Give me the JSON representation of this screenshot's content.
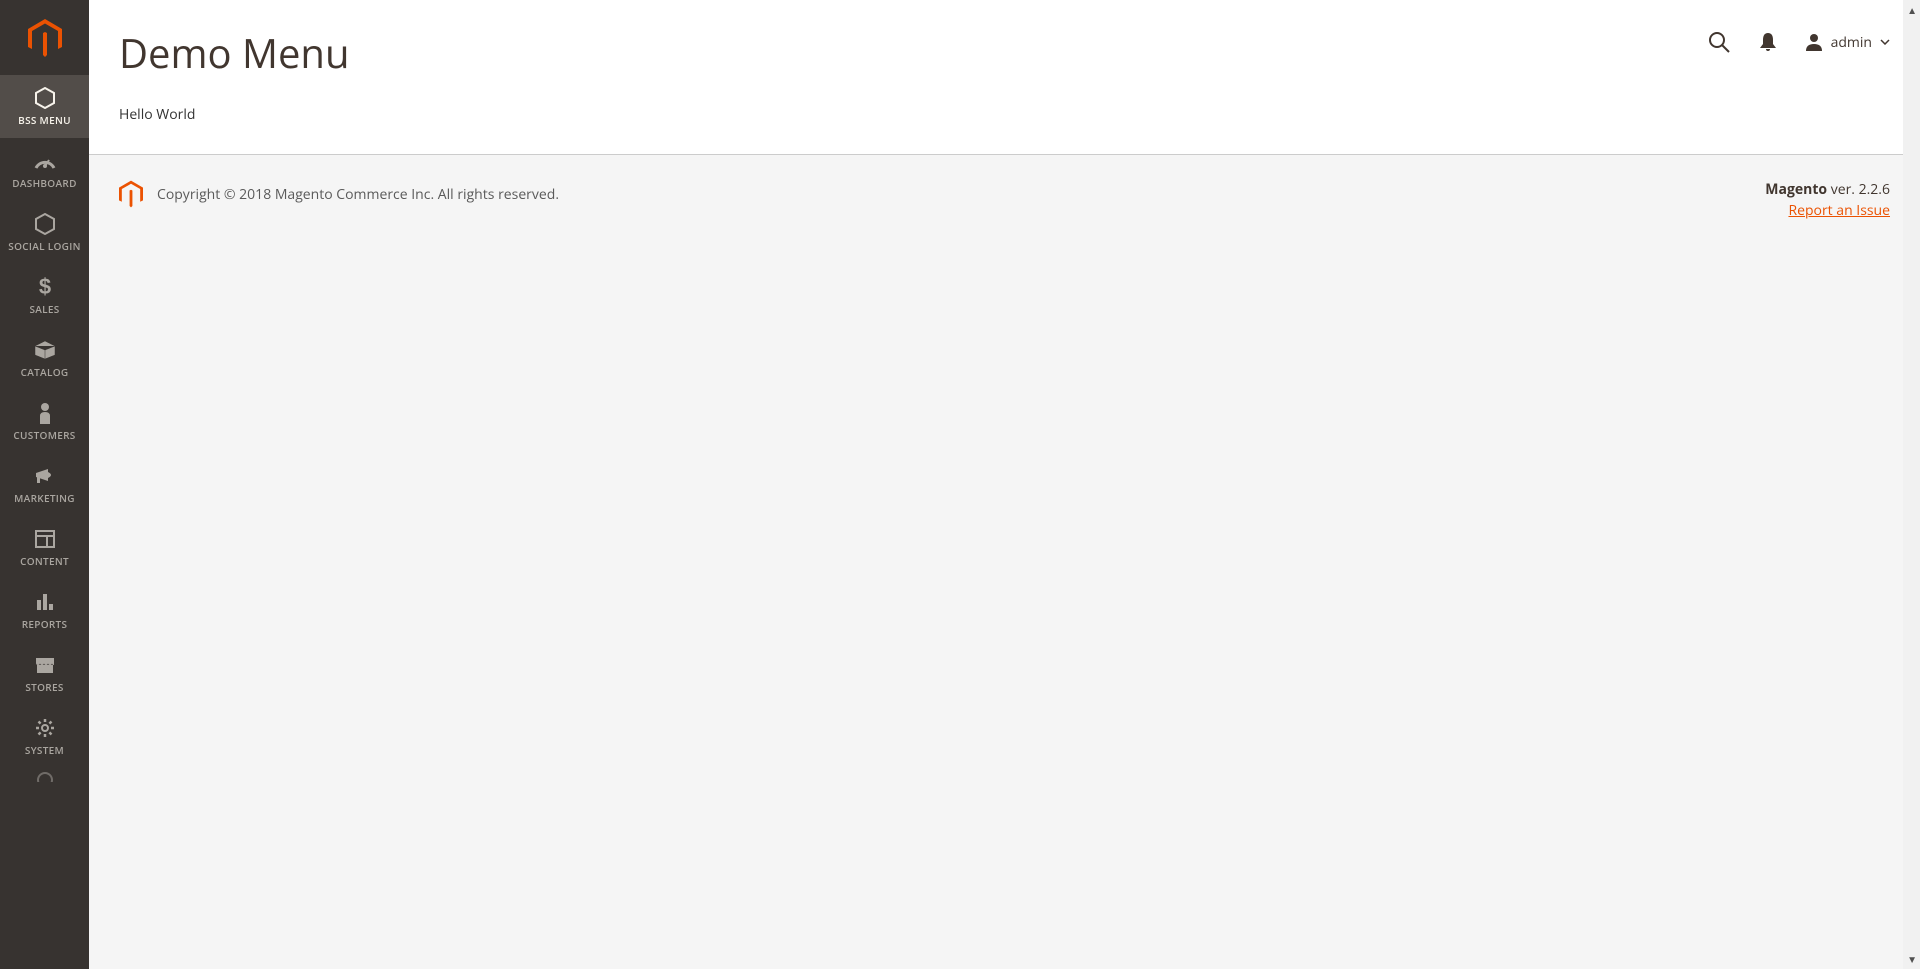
{
  "sidebar": {
    "items": [
      {
        "label": "BSS MENU",
        "icon": "hexagon",
        "active": true
      },
      {
        "label": "DASHBOARD",
        "icon": "gauge",
        "active": false
      },
      {
        "label": "SOCIAL LOGIN",
        "icon": "hexagon-outline",
        "active": false
      },
      {
        "label": "SALES",
        "icon": "dollar",
        "active": false
      },
      {
        "label": "CATALOG",
        "icon": "box",
        "active": false
      },
      {
        "label": "CUSTOMERS",
        "icon": "person",
        "active": false
      },
      {
        "label": "MARKETING",
        "icon": "megaphone",
        "active": false
      },
      {
        "label": "CONTENT",
        "icon": "layout",
        "active": false
      },
      {
        "label": "REPORTS",
        "icon": "bars",
        "active": false
      },
      {
        "label": "STORES",
        "icon": "store",
        "active": false
      },
      {
        "label": "SYSTEM",
        "icon": "gear",
        "active": false
      }
    ]
  },
  "header": {
    "title": "Demo Menu",
    "user_name": "admin"
  },
  "content": {
    "body_text": "Hello World"
  },
  "footer": {
    "copyright": "Copyright © 2018 Magento Commerce Inc. All rights reserved.",
    "product_name": "Magento",
    "version_label": " ver. 2.2.6",
    "report_link": "Report an Issue"
  }
}
